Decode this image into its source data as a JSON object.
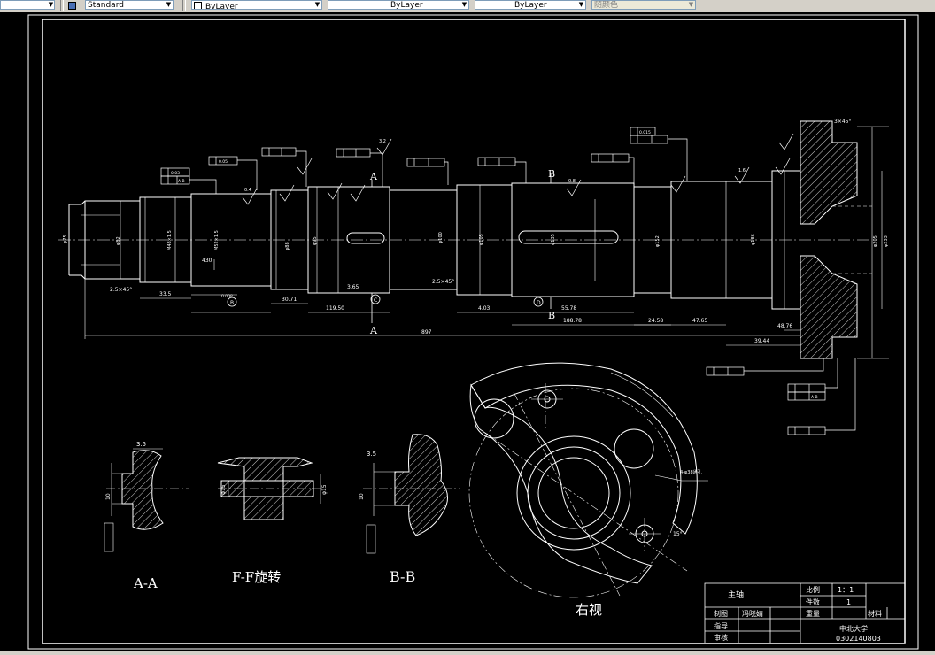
{
  "toolbar": {
    "text_style": "Standard",
    "layer": "ByLayer",
    "linetype": "ByLayer",
    "lineweight": "ByLayer",
    "plot_style": "随颜色"
  },
  "drawing": {
    "labels": {
      "section_aa_cut": "A",
      "section_aa_cut2": "A",
      "section_bb_cut": "B",
      "section_bb_cut2": "B",
      "detail_c": "C",
      "detail_b": "B",
      "detail_d": "D",
      "view_aa": "A-A",
      "view_ff": "F-F旋转",
      "view_bb": "B-B",
      "view_right": "右视"
    },
    "dimensions": {
      "overall_length": "897",
      "len_1": "33.5",
      "len_2": "430",
      "len_3": "30.71",
      "len_4": "119.50",
      "len_5": "3.65",
      "len_6": "4.03",
      "len_7": "55.78",
      "len_8": "188.78",
      "len_9": "24.58",
      "len_10": "47.65",
      "len_11": "39.44",
      "len_12": "48.76",
      "chamfer_1": "2.5×45°",
      "chamfer_2": "2.5×45°",
      "chamfer_3": "3×45°",
      "dia_1": "φ75",
      "dia_2": "φ82",
      "dia_3": "φ88",
      "dia_4": "φ95",
      "dia_5": "φ100",
      "dia_6": "φ105",
      "dia_7": "φ135",
      "dia_8": "φ152",
      "dia_9": "φ186",
      "dia_10": "φ205",
      "dia_11": "φ233",
      "thread_1": "M48×1.5",
      "thread_2": "M52×1.5",
      "aa_depth": "3.5",
      "aa_width": "10",
      "ff_dia": "φ15",
      "ff_dia2": "φ15",
      "bb_depth": "3.5",
      "bb_width": "10",
      "right_holes": "4-φ38通孔",
      "right_angle": "15°",
      "roughness_1": "0.4",
      "roughness_2": "0.8",
      "roughness_3": "1.6",
      "roughness_4": "3.2",
      "tol_1": "0.03",
      "tol_2": "0.05",
      "tol_3": "0.015",
      "tol_4": "0.008",
      "datum_1": "A-B",
      "datum_2": "A-B"
    },
    "title_block": {
      "part_name": "主轴",
      "scale_label": "比例",
      "scale_value": "1：1",
      "qty_label": "件数",
      "qty_value": "1",
      "weight_label": "重量",
      "material_label": "材料",
      "drawn_label": "制图",
      "drawn_by": "冯晓婧",
      "guide_label": "指导",
      "review_label": "审核",
      "school": "中北大学",
      "student_id": "0302140803"
    }
  }
}
